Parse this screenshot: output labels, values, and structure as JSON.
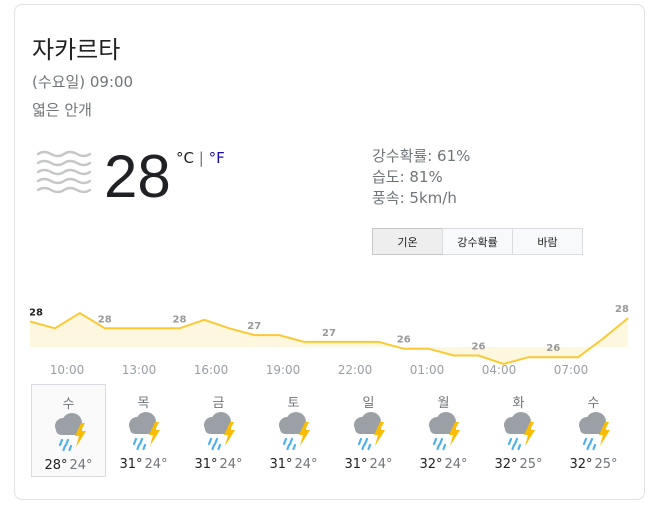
{
  "location": "자카르타",
  "datetime": "(수요일) 09:00",
  "condition": "엷은 안개",
  "current": {
    "temperature": "28",
    "unit_c": "°C",
    "unit_sep": "|",
    "unit_f": "°F",
    "icon": "haze-icon"
  },
  "details": {
    "precip": "강수확률: 61%",
    "humidity": "습도: 81%",
    "wind": "풍속: 5km/h"
  },
  "tabs": [
    {
      "label": "기온",
      "active": true
    },
    {
      "label": "강수확률",
      "active": false
    },
    {
      "label": "바람",
      "active": false
    }
  ],
  "chart_data": {
    "type": "area",
    "x": [
      "09:00",
      "10:00",
      "11:00",
      "12:00",
      "13:00",
      "14:00",
      "15:00",
      "16:00",
      "17:00",
      "18:00",
      "19:00",
      "20:00",
      "21:00",
      "22:00",
      "23:00",
      "00:00",
      "01:00",
      "02:00",
      "03:00",
      "04:00",
      "05:00",
      "06:00",
      "07:00",
      "08:00",
      "09:00"
    ],
    "tick_labels": [
      "10:00",
      "13:00",
      "16:00",
      "19:00",
      "22:00",
      "01:00",
      "04:00",
      "07:00"
    ],
    "values": [
      28,
      27.6,
      28.5,
      27.6,
      27.6,
      27.6,
      27.6,
      28.1,
      27.6,
      27.2,
      27.2,
      26.8,
      26.8,
      26.8,
      26.8,
      26.4,
      26.4,
      26,
      26,
      25.5,
      25.9,
      25.9,
      25.9,
      27,
      28.2
    ],
    "labels": [
      {
        "index": 0,
        "text": "28"
      },
      {
        "index": 3,
        "text": "28"
      },
      {
        "index": 6,
        "text": "28"
      },
      {
        "index": 9,
        "text": "27"
      },
      {
        "index": 12,
        "text": "27"
      },
      {
        "index": 15,
        "text": "26"
      },
      {
        "index": 18,
        "text": "26"
      },
      {
        "index": 21,
        "text": "26"
      },
      {
        "index": 24,
        "text": "28"
      }
    ],
    "color": "#fcc934",
    "fill": "#fef7e0"
  },
  "days": [
    {
      "name": "수",
      "hi": "28°",
      "lo": "24°",
      "icon": "thunderstorm-icon",
      "active": true
    },
    {
      "name": "목",
      "hi": "31°",
      "lo": "24°",
      "icon": "thunderstorm-icon",
      "active": false
    },
    {
      "name": "금",
      "hi": "31°",
      "lo": "24°",
      "icon": "thunderstorm-icon",
      "active": false
    },
    {
      "name": "토",
      "hi": "31°",
      "lo": "24°",
      "icon": "thunderstorm-icon",
      "active": false
    },
    {
      "name": "일",
      "hi": "31°",
      "lo": "24°",
      "icon": "thunderstorm-icon",
      "active": false
    },
    {
      "name": "월",
      "hi": "32°",
      "lo": "24°",
      "icon": "thunderstorm-icon",
      "active": false
    },
    {
      "name": "화",
      "hi": "32°",
      "lo": "25°",
      "icon": "thunderstorm-icon",
      "active": false
    },
    {
      "name": "수",
      "hi": "32°",
      "lo": "25°",
      "icon": "thunderstorm-icon",
      "active": false
    }
  ]
}
